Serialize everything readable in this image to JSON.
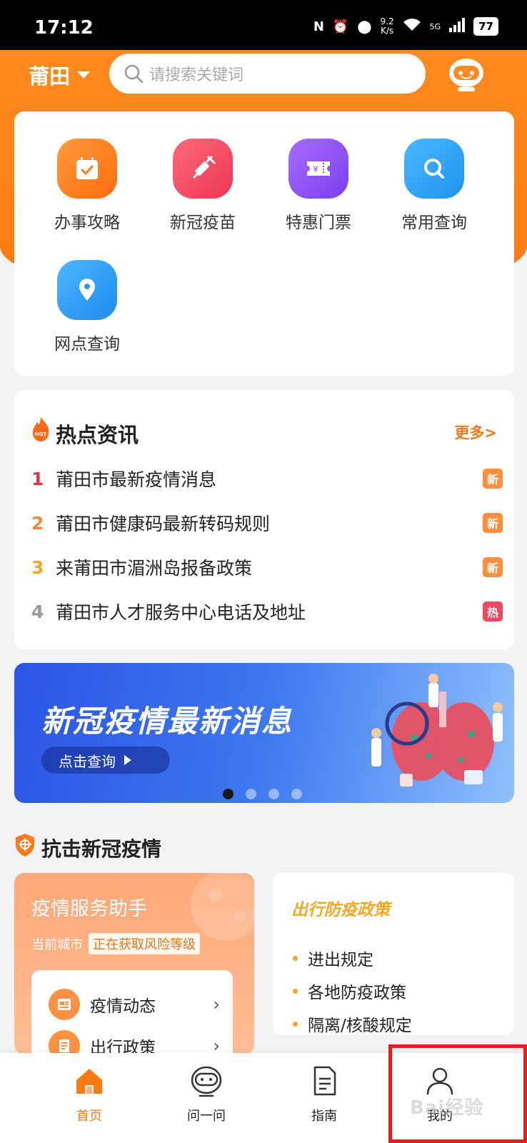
{
  "status_bar": {
    "time": "17:12",
    "speed_value": "9.2",
    "speed_unit": "K/s",
    "network": "5G",
    "battery": "77"
  },
  "header": {
    "city": "莆田",
    "search_placeholder": "请搜索关键词"
  },
  "services": [
    {
      "label": "办事攻略",
      "icon": "calendar-check-icon",
      "color": "#ff7a1a"
    },
    {
      "label": "新冠疫苗",
      "icon": "syringe-icon",
      "color": "#f2475f"
    },
    {
      "label": "特惠门票",
      "icon": "ticket-icon",
      "color": "#8f55f0"
    },
    {
      "label": "常用查询",
      "icon": "search-icon",
      "color": "#2ea3f2"
    },
    {
      "label": "网点查询",
      "icon": "location-pin-icon",
      "color": "#2f9bf0"
    }
  ],
  "hot_news": {
    "title": "热点资讯",
    "more": "更多>",
    "items": [
      {
        "num": "1",
        "text": "莆田市最新疫情消息",
        "tag": "新",
        "num_color": "#e5333f",
        "tag_color": "#ff8f3c"
      },
      {
        "num": "2",
        "text": "莆田市健康码最新转码规则",
        "tag": "新",
        "num_color": "#f08a3c",
        "tag_color": "#ff8f3c"
      },
      {
        "num": "3",
        "text": "来莆田市湄洲岛报备政策",
        "tag": "新",
        "num_color": "#f5a623",
        "tag_color": "#ff8f3c"
      },
      {
        "num": "4",
        "text": "莆田市人才服务中心电话及地址",
        "tag": "热",
        "num_color": "#999999",
        "tag_color": "#f2475f"
      }
    ]
  },
  "banner": {
    "title": "新冠疫情最新消息",
    "button": "点击查询",
    "active_dot": 0,
    "dot_count": 4
  },
  "fight": {
    "title": "抗击新冠疫情",
    "assistant": {
      "title": "疫情服务助手",
      "city_label": "当前城市",
      "risk_status": "正在获取风险等级",
      "items": [
        "疫情动态",
        "出行政策"
      ]
    },
    "policy": {
      "title": "出行防疫政策",
      "items": [
        "进出规定",
        "各地防疫政策",
        "隔离/核酸规定"
      ]
    }
  },
  "bottom_nav": [
    {
      "label": "首页",
      "icon": "home-icon",
      "active": true
    },
    {
      "label": "问一问",
      "icon": "robot-icon",
      "active": false
    },
    {
      "label": "指南",
      "icon": "document-icon",
      "active": false
    },
    {
      "label": "我的",
      "icon": "user-icon",
      "active": false
    }
  ],
  "watermark": "Bai经验"
}
